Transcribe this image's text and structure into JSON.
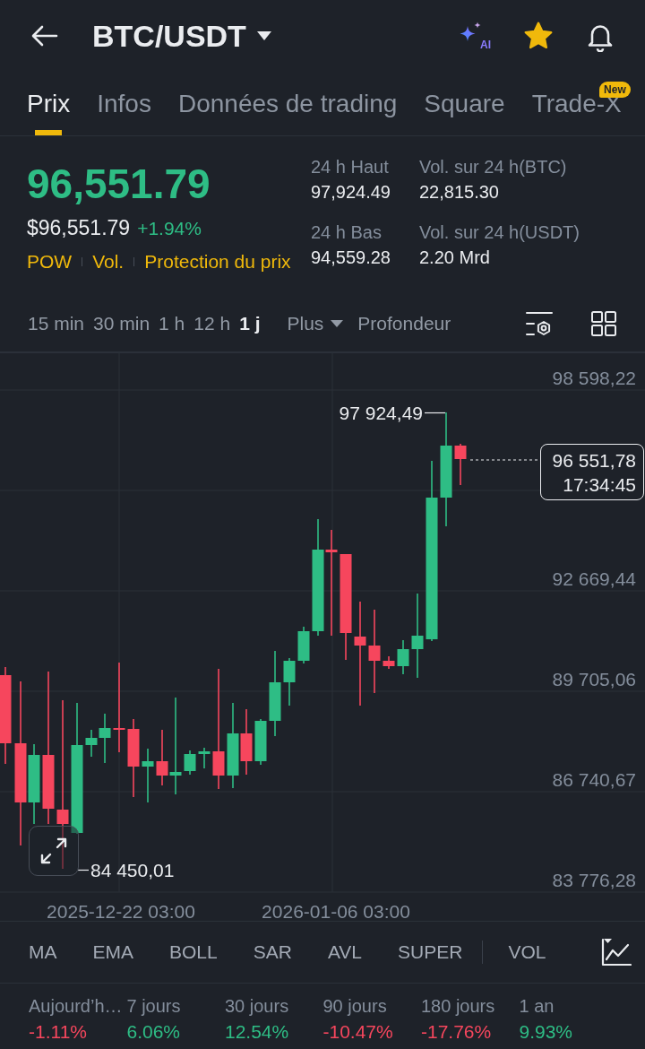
{
  "header": {
    "title": "BTC/USDT",
    "ai_label": "AI",
    "favorite": true
  },
  "tabs": [
    {
      "label": "Prix",
      "selected": true
    },
    {
      "label": "Infos",
      "selected": false
    },
    {
      "label": "Données de trading",
      "selected": false
    },
    {
      "label": "Square",
      "selected": false
    },
    {
      "label": "Trade-X",
      "selected": false,
      "badge": "New"
    }
  ],
  "ticker": {
    "price": "96,551.79",
    "fiat_price": "$96,551.79",
    "change": "+1.94%",
    "color": "#2ebd85",
    "tags": [
      "POW",
      "Vol.",
      "Protection du prix"
    ]
  },
  "stats": [
    {
      "label": "24 h Haut",
      "value": "97,924.49"
    },
    {
      "label": "Vol. sur 24 h(BTC)",
      "value": "22,815.30"
    },
    {
      "label": "24 h Bas",
      "value": "94,559.28"
    },
    {
      "label": "Vol. sur 24 h(USDT)",
      "value": "2.20 Mrd"
    }
  ],
  "intervals": [
    {
      "label": "15 min",
      "selected": false
    },
    {
      "label": "30 min",
      "selected": false
    },
    {
      "label": "1 h",
      "selected": false
    },
    {
      "label": "12 h",
      "selected": false
    },
    {
      "label": "1 j",
      "selected": true
    }
  ],
  "interval_tools": {
    "more": "Plus",
    "depth": "Profondeur"
  },
  "chart": {
    "y_labels": [
      "98 598,22",
      "92 669,44",
      "89 705,06",
      "86 740,67",
      "83 776,28"
    ],
    "x_labels": [
      "2025-12-22 03:00",
      "2026-01-06 03:00"
    ],
    "high_label": "97 924,49",
    "low_label": "84 450,01",
    "price_tag": {
      "price": "96 551,78",
      "countdown": "17:34:45"
    }
  },
  "indicators": [
    "MA",
    "EMA",
    "BOLL",
    "SAR",
    "AVL",
    "SUPER",
    "VOL"
  ],
  "performance": [
    {
      "period": "Aujourd’h…",
      "change": "-1.11%",
      "color": "#f6465d"
    },
    {
      "period": "7 jours",
      "change": "6.06%",
      "color": "#2ebd85"
    },
    {
      "period": "30 jours",
      "change": "12.54%",
      "color": "#2ebd85"
    },
    {
      "period": "90 jours",
      "change": "-10.47%",
      "color": "#f6465d"
    },
    {
      "period": "180 jours",
      "change": "-17.76%",
      "color": "#f6465d"
    },
    {
      "period": "1 an",
      "change": "9.93%",
      "color": "#2ebd85"
    }
  ]
}
